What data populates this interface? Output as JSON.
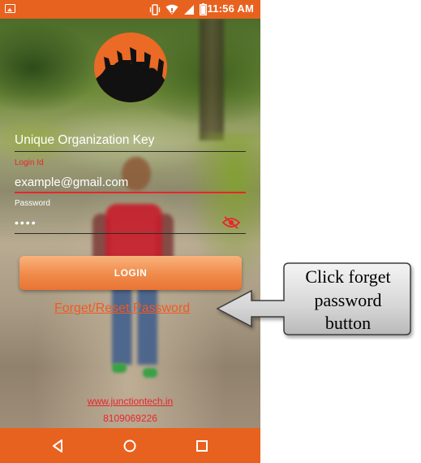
{
  "status_bar": {
    "time": "11:56 AM",
    "icons": [
      "gallery-icon",
      "vibrate-icon",
      "wifi-icon",
      "signal-icon",
      "battery-icon"
    ]
  },
  "logo": {
    "name": "graduates-logo",
    "color": "#ea6a26"
  },
  "form": {
    "org_key_placeholder": "Unique Organization Key",
    "login_id_label": "Login Id",
    "login_id_value": "example@gmail.com",
    "password_label": "Password",
    "password_value": "••••",
    "visibility_icon": "eye-off-icon"
  },
  "login_button": {
    "label": "LOGIN"
  },
  "forget_link": {
    "label": "Forget/Reset Password"
  },
  "footer": {
    "website": "www.junctiontech.in",
    "phone": "8109069226"
  },
  "nav_bar": {
    "icons": [
      "back-icon",
      "home-icon",
      "recents-icon"
    ]
  },
  "callout": {
    "lines": [
      "Click forget",
      "password",
      "button"
    ]
  },
  "colors": {
    "accent": "#e8621f",
    "link": "#f15a22",
    "error_red": "#e8262b",
    "button_gradient_top": "#f9b37c",
    "button_gradient_bottom": "#e97434"
  }
}
